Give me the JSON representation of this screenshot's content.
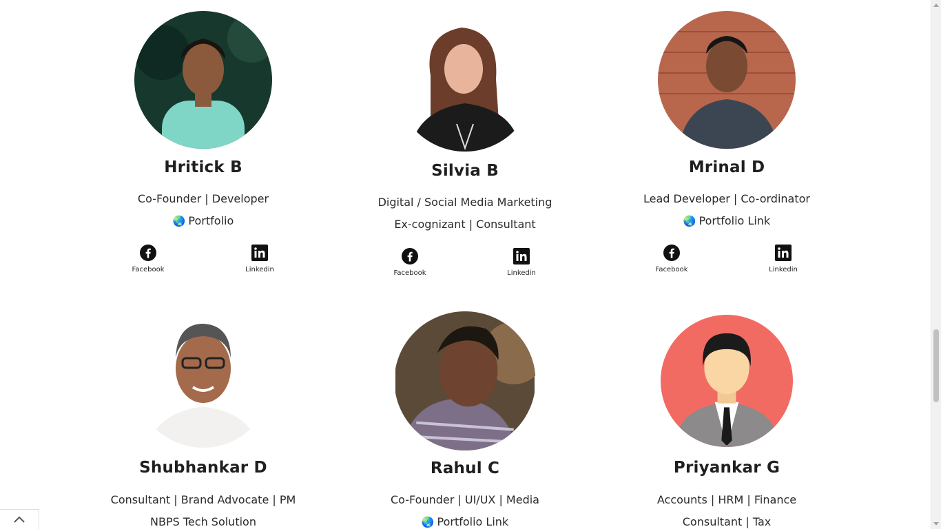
{
  "members": [
    {
      "name": "Hritick B",
      "role": "Co-Founder | Developer",
      "extra": "Portfolio",
      "extra_has_globe": true,
      "facebook": "Facebook",
      "linkedin": "Linkedin"
    },
    {
      "name": "Silvia B",
      "role": "Digital / Social Media Marketing",
      "extra": "Ex-cognizant | Consultant",
      "extra_has_globe": false,
      "facebook": "Facebook",
      "linkedin": "Linkedin"
    },
    {
      "name": "Mrinal D",
      "role": "Lead Developer | Co-ordinator",
      "extra": "Portfolio Link",
      "extra_has_globe": true,
      "facebook": "Facebook",
      "linkedin": "Linkedin"
    },
    {
      "name": "Shubhankar D",
      "role": "Consultant | Brand Advocate | PM",
      "extra": "NBPS Tech Solution",
      "extra_has_globe": false
    },
    {
      "name": "Rahul C",
      "role": "Co-Founder | UI/UX | Media",
      "extra": "Portfolio Link",
      "extra_has_globe": true
    },
    {
      "name": "Priyankar G",
      "role": "Accounts | HRM | Finance",
      "extra": "Consultant | Tax",
      "extra_has_globe": false
    }
  ],
  "icons": {
    "globe": "🌏",
    "facebook": "facebook-icon",
    "linkedin": "linkedin-icon",
    "back_to_top": "chevron-up-icon"
  },
  "colors": {
    "avatar_bg_priyankar": "#f26b63",
    "text": "#222222"
  }
}
